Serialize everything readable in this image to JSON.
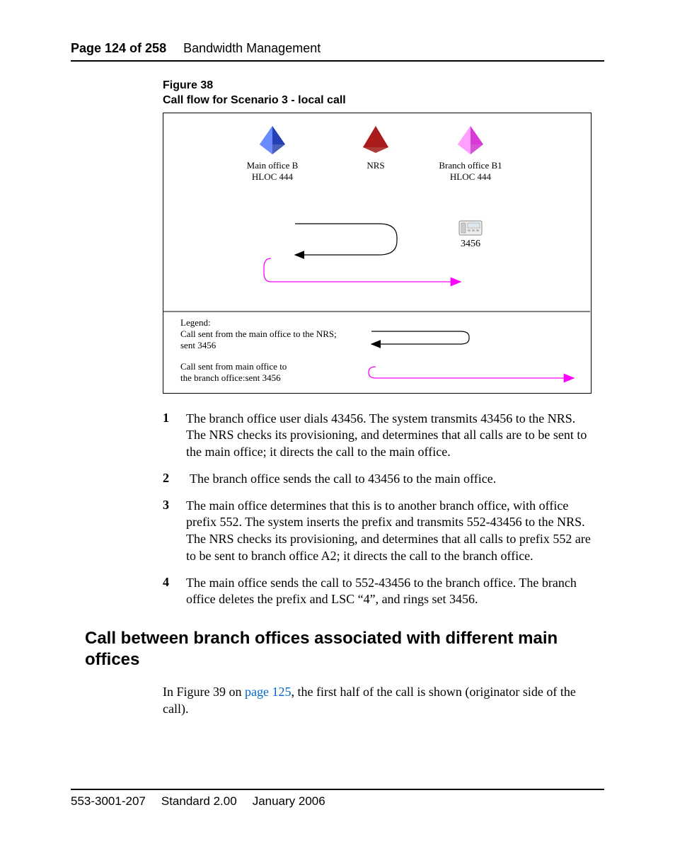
{
  "header": {
    "page_num": "Page 124 of 258",
    "chapter": "Bandwidth Management"
  },
  "figure": {
    "label_line1": "Figure 38",
    "label_line2": "Call flow for Scenario 3 - local call",
    "node_main_office_b": "Main office B",
    "node_main_office_b_hloc": "HLOC 444",
    "node_nrs": "NRS",
    "node_branch_b1": "Branch office B1",
    "node_branch_b1_hloc": "HLOC 444",
    "phone_ext": "3456",
    "legend_title": "Legend:",
    "legend1a": "Call sent from the main office to the NRS;",
    "legend1b": "sent 3456",
    "legend2a": "Call sent from main office to",
    "legend2b": "the branch office:sent 3456"
  },
  "steps": [
    {
      "n": "1",
      "t": "The branch office user dials 43456. The system transmits 43456 to the NRS. The NRS checks its provisioning, and determines that all calls are to be sent to the main office; it directs the call to the main office."
    },
    {
      "n": "2",
      "t": "The branch office sends the call to 43456 to the main office."
    },
    {
      "n": "3",
      "t": "The main office determines that this is to another branch office, with office prefix 552. The system inserts the prefix and transmits 552-43456 to the NRS. The NRS checks its provisioning, and determines that all calls to prefix 552 are to be sent to branch office A2; it directs the call to the branch office."
    },
    {
      "n": "4",
      "t": "The main office sends the call to 552-43456 to the branch office. The branch office deletes the prefix and LSC “4”, and rings set 3456."
    }
  ],
  "section_heading": "Call between branch offices associated with different main offices",
  "para": {
    "pre": "In Figure 39 on ",
    "link": "page 125",
    "post": ", the first half of the call is shown (originator side of the call)."
  },
  "footer": {
    "docnum": "553-3001-207",
    "standard": "Standard 2.00",
    "date": "January 2006"
  }
}
